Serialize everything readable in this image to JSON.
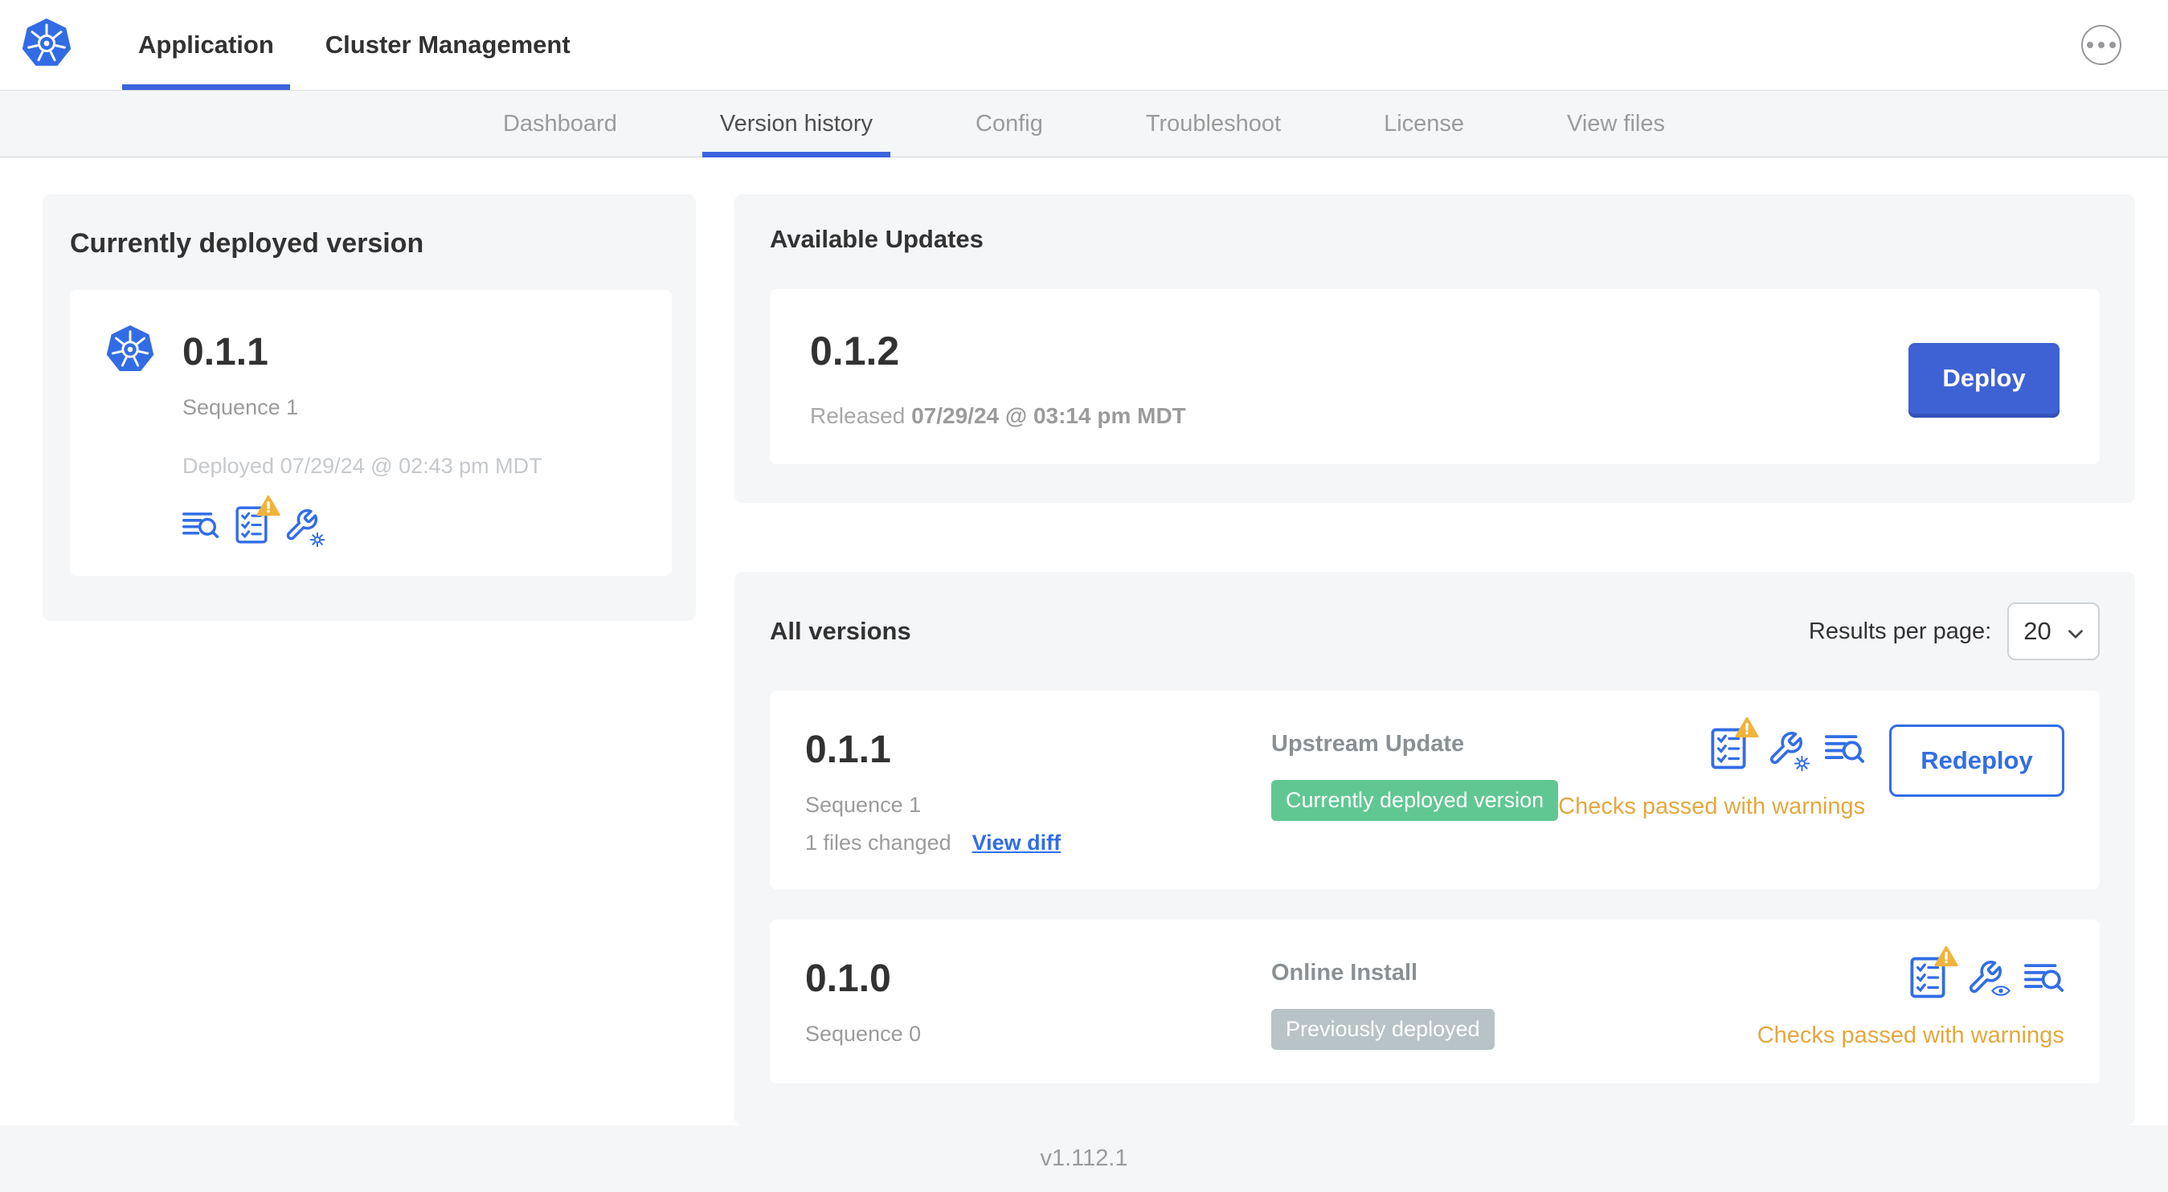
{
  "header": {
    "tabs": [
      {
        "label": "Application",
        "active": true
      },
      {
        "label": "Cluster Management",
        "active": false
      }
    ]
  },
  "subnav": {
    "tabs": [
      {
        "label": "Dashboard",
        "active": false
      },
      {
        "label": "Version history",
        "active": true
      },
      {
        "label": "Config",
        "active": false
      },
      {
        "label": "Troubleshoot",
        "active": false
      },
      {
        "label": "License",
        "active": false
      },
      {
        "label": "View files",
        "active": false
      }
    ]
  },
  "deployed_card": {
    "title": "Currently deployed version",
    "version": "0.1.1",
    "sequence": "Sequence 1",
    "deployed_at": "Deployed 07/29/24 @ 02:43 pm MDT"
  },
  "available_updates": {
    "title": "Available Updates",
    "version": "0.1.2",
    "released_label": "Released",
    "released_at": "07/29/24 @ 03:14 pm MDT",
    "deploy_label": "Deploy"
  },
  "all_versions": {
    "title": "All versions",
    "results_per_page_label": "Results per page:",
    "results_per_page_value": "20",
    "rows": [
      {
        "version": "0.1.1",
        "sequence": "Sequence 1",
        "files_changed": "1 files changed",
        "view_diff_label": "View diff",
        "source": "Upstream Update",
        "badge": "Currently deployed version",
        "badge_color": "#61c792",
        "status": "Checks passed with warnings",
        "action_label": "Redeploy"
      },
      {
        "version": "0.1.0",
        "sequence": "Sequence 0",
        "source": "Online Install",
        "badge": "Previously deployed",
        "badge_color": "#b8c3c7",
        "status": "Checks passed with warnings"
      }
    ]
  },
  "footer": {
    "app_version": "v1.112.1"
  },
  "icons": {
    "app_logo": "kubernetes-logo",
    "more": "ellipsis-icon",
    "release_notes": "release-notes-icon",
    "preflight": "preflight-checklist-icon",
    "preflight_warning": "warning-triangle-icon",
    "edit_config": "wrench-gear-icon",
    "view_config": "wrench-eye-icon",
    "dropdown": "chevron-down-icon"
  },
  "colors": {
    "accent_blue": "#326de6",
    "active_underline": "#3b63dd",
    "deploy_button": "#3e62d4",
    "badge_green": "#61c792",
    "badge_gray": "#b8c3c7",
    "warning_text": "#e5a73e",
    "warning_triangle": "#f0b43c",
    "panel_gray": "#f5f6f8"
  }
}
